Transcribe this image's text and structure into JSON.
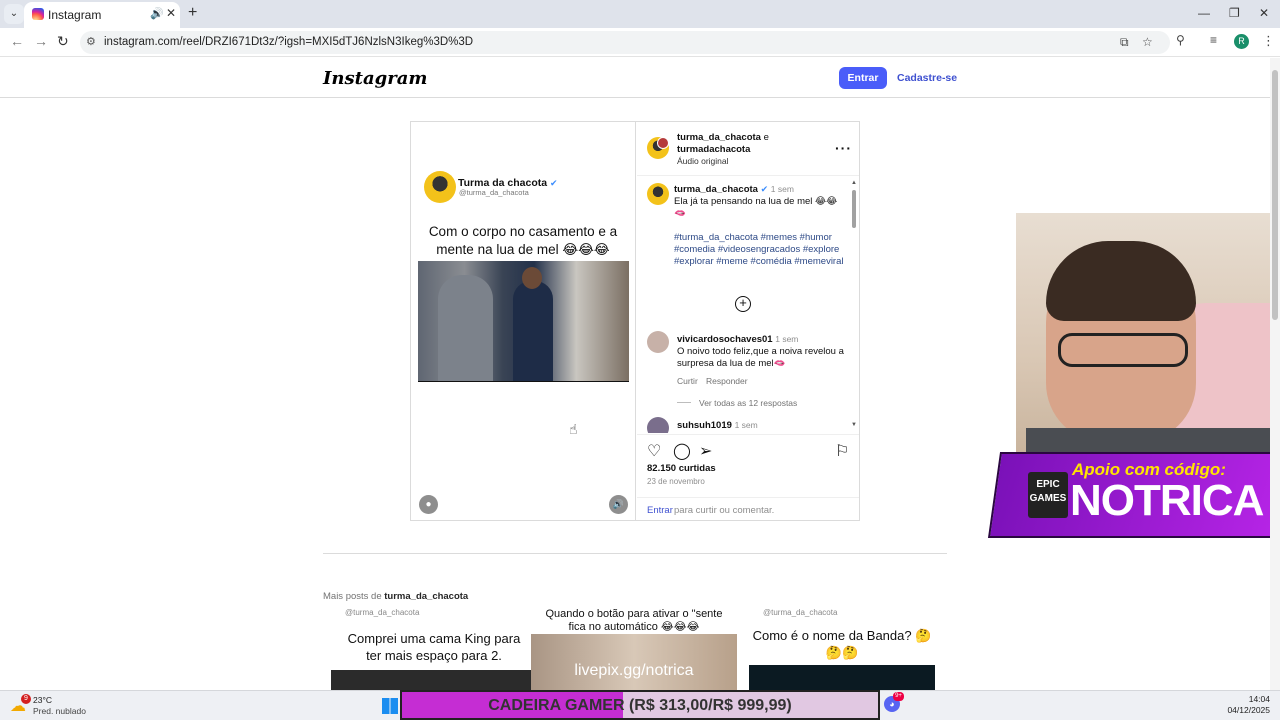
{
  "browser": {
    "tab_title": "Instagram",
    "new_tab": "+",
    "url": "instagram.com/reel/DRZI671Dt3z/?igsh=MXI5dTJ6NzlsN3Ikeg%3D%3D",
    "profile_initial": "R"
  },
  "header": {
    "logo": "Instagram",
    "login_label": "Entrar",
    "signup_label": "Cadastre-se"
  },
  "post_media": {
    "account_name": "Turma da chacota",
    "account_handle": "@turma_da_chacota",
    "caption": "Com o corpo no casamento e a mente na lua de mel 😂😂😂"
  },
  "post_header": {
    "author_1": "turma_da_chacota",
    "conjunction": "e",
    "author_2": "turmadachacota",
    "audio": "Áudio original"
  },
  "caption_comment": {
    "user": "turma_da_chacota",
    "time": "1 sem",
    "text": "Ela já ta pensando na lua de mel 😂😂🫦",
    "hashtags": "#turma_da_chacota #memes #humor #comedia #videosengracados #explore #explorar #meme #comédia #memeviral"
  },
  "comments": [
    {
      "user": "vivicardosochaves01",
      "time": "1 sem",
      "text": "O noivo todo feliz,que a noiva revelou a surpresa da lua de mel🫦",
      "reply_label": "Curtir",
      "answer_label": "Responder",
      "view_replies": "Ver todas as 12 respostas"
    },
    {
      "user": "suhsuh1019",
      "time": "1 sem"
    }
  ],
  "post_actions": {
    "likes": "82.150 curtidas",
    "date": "23 de novembro",
    "login_link": "Entrar",
    "login_rest": "para curtir ou comentar."
  },
  "more_posts": {
    "prefix": "Mais posts de",
    "account": "turma_da_chacota",
    "items": [
      {
        "handle": "@turma_da_chacota",
        "caption": "Comprei uma cama King para ter mais espaço para 2."
      },
      {
        "handle": "",
        "caption": "Quando o botão para ativar o \"sente fica no automático 😂😂😂"
      },
      {
        "handle": "@turma_da_chacota",
        "caption": "Como é o nome da Banda? 🤔🤔🤔"
      }
    ],
    "overlay_text": "livepix.gg/notrica"
  },
  "stream_overlay": {
    "promo_top": "Apoio com código:",
    "promo_code": "NOTRICA",
    "epic_label": "EPIC GAMES",
    "banner": "CADEIRA GAMER (R$ 313,00/R$ 999,99)",
    "banner_progress": 0.313
  },
  "taskbar": {
    "weather_badge": "9",
    "temperature": "23°C",
    "forecast": "Pred. nublado",
    "discord_badge": "9+",
    "time": "14:04",
    "date": "04/12/2025"
  }
}
